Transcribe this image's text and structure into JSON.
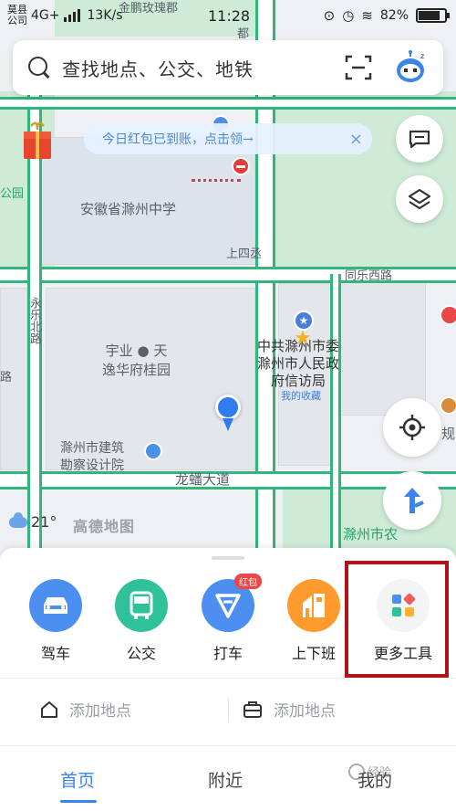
{
  "status_bar": {
    "carrier_fragment": "莫县\n公司",
    "network": "4G+",
    "speed": "13K/s",
    "time": "11:28",
    "battery": "82%",
    "battery_level": 0.82
  },
  "search": {
    "placeholder": "查找地点、公交、地铁",
    "icons": [
      "search-icon",
      "scan-icon",
      "assistant-avatar-icon"
    ]
  },
  "promo": {
    "text": "今日红包已到账，点击领→",
    "close": "×"
  },
  "map": {
    "labels": {
      "top_road": "金鹏玫瑰郡",
      "top_right": "都",
      "park": "公园",
      "school": "安徽省滁州中学",
      "road_shangsi": "上四丞",
      "road_tongle": "同乐西路",
      "side_road": "永乐北路",
      "side_left": "路",
      "community_line1": "宇业",
      "community_line2": "天",
      "community_line3": "逸华府桂园",
      "gov_line1": "中共滁州市委",
      "gov_line2": "滁州市人民政",
      "gov_line3": "府信访局",
      "favorite": "我的收藏",
      "institute_line1": "滁州市建筑",
      "institute_line2": "勘察设计院",
      "road_longpan": "龙蟠大道",
      "bottom_right": "滁州市农",
      "right_edge": "规"
    }
  },
  "weather": {
    "temp": "21°",
    "icon": "cloud-icon"
  },
  "map_logo": "高德地图",
  "tools": [
    {
      "label": "驾车",
      "icon": "car-icon",
      "color": "#4c8ff0"
    },
    {
      "label": "公交",
      "icon": "bus-icon",
      "color": "#2fc29a"
    },
    {
      "label": "打车",
      "icon": "taxi-icon",
      "color": "#4c8ff0",
      "badge": "红包"
    },
    {
      "label": "上下班",
      "icon": "commute-icon",
      "color": "#ff9a2e"
    },
    {
      "label": "更多工具",
      "icon": "more-tools-icon",
      "color": "#f3f4f6"
    }
  ],
  "places": [
    {
      "label": "添加地点",
      "icon": "home-icon"
    },
    {
      "label": "添加地点",
      "icon": "briefcase-icon"
    }
  ],
  "tabs": [
    {
      "label": "首页",
      "active": true
    },
    {
      "label": "附近",
      "active": false
    },
    {
      "label": "我的",
      "active": false
    }
  ],
  "watermark": "经验"
}
